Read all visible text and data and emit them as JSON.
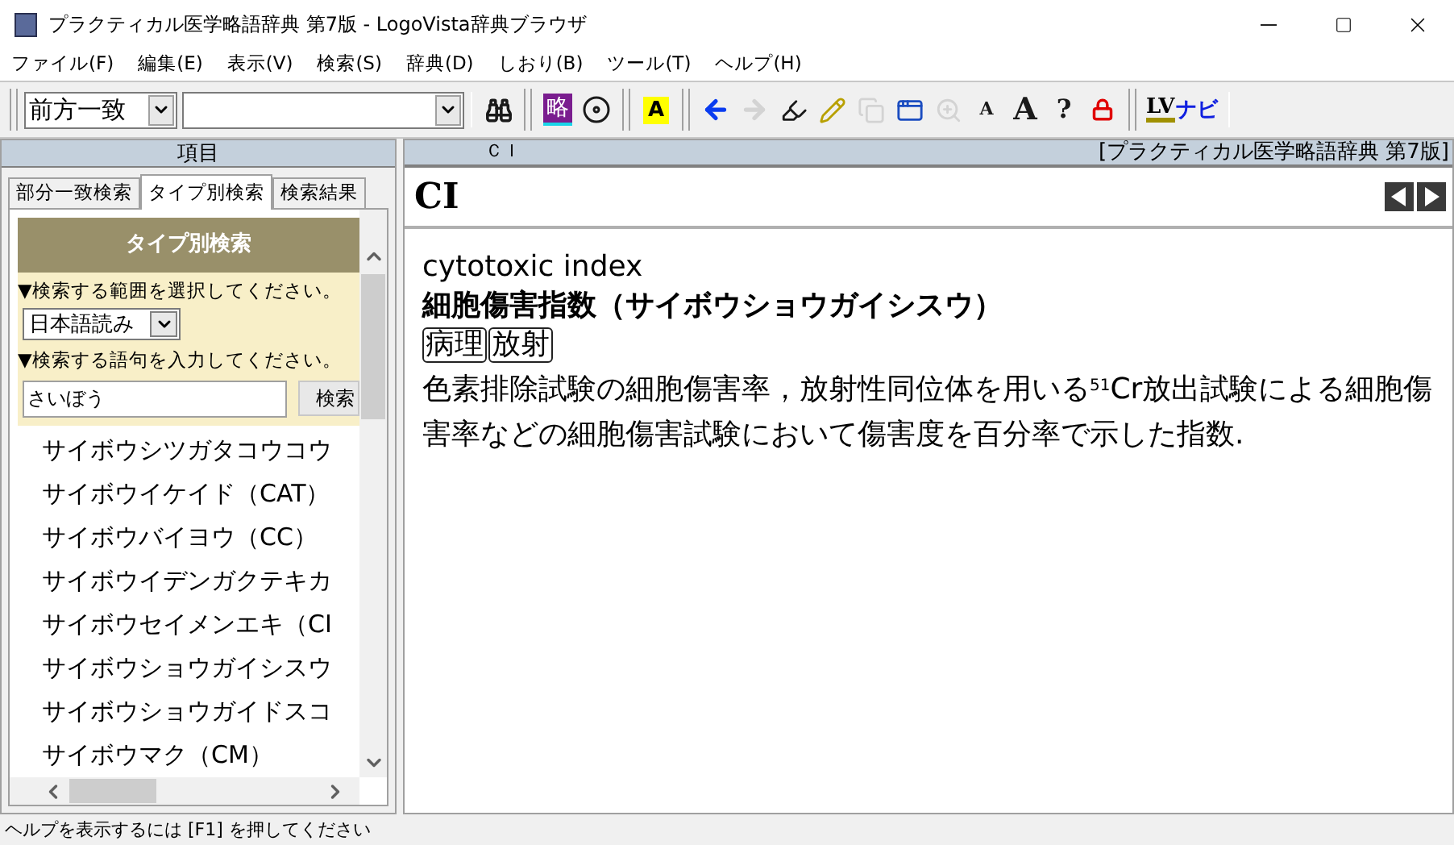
{
  "window": {
    "title": "プラクティカル医学略語辞典 第7版 - LogoVista辞典ブラウザ"
  },
  "menu": [
    "ファイル(F)",
    "編集(E)",
    "表示(V)",
    "検索(S)",
    "辞典(D)",
    "しおり(B)",
    "ツール(T)",
    "ヘルプ(H)"
  ],
  "toolbar": {
    "match_mode": "前方一致",
    "buttons": [
      {
        "kind": "binoculars",
        "disabled": false
      },
      {
        "kind": "sep"
      },
      {
        "kind": "abbr",
        "label": "略",
        "disabled": false
      },
      {
        "kind": "disc",
        "disabled": false
      },
      {
        "kind": "sep"
      },
      {
        "kind": "highlight",
        "label": "A",
        "disabled": false
      },
      {
        "kind": "sep"
      },
      {
        "kind": "back",
        "disabled": false
      },
      {
        "kind": "forward",
        "disabled": true
      },
      {
        "kind": "marker",
        "disabled": false
      },
      {
        "kind": "pencil",
        "disabled": false
      },
      {
        "kind": "copy",
        "disabled": true
      },
      {
        "kind": "window",
        "disabled": false
      },
      {
        "kind": "zoom",
        "disabled": true
      },
      {
        "kind": "font_small",
        "label": "A",
        "disabled": false
      },
      {
        "kind": "font_large",
        "label": "A",
        "disabled": false
      },
      {
        "kind": "help",
        "label": "?",
        "disabled": false
      },
      {
        "kind": "lock",
        "disabled": false
      },
      {
        "kind": "sep"
      },
      {
        "kind": "nav",
        "label": "LV",
        "label_2": "ナビ",
        "disabled": false
      }
    ]
  },
  "left_pane": {
    "header": "項目",
    "tabs": [
      {
        "label": "部分一致検索",
        "selected": false
      },
      {
        "label": "タイプ別検索",
        "selected": true
      },
      {
        "label": "検索結果",
        "selected": false
      }
    ],
    "panel_title": "タイプ別検索",
    "range_label": "▼検索する範囲を選択してください。",
    "range_value": "日本語読み",
    "term_label": "▼検索する語句を入力してください。",
    "term_value": "さいぼう",
    "search_button": "検索",
    "results": [
      {
        "text": "サイボウシツガタコウコウ",
        "selected": false
      },
      {
        "text": "サイボウイケイド（CAT）",
        "selected": false
      },
      {
        "text": "サイボウバイヨウ（CC）",
        "selected": false
      },
      {
        "text": "サイボウイデンガクテキカ",
        "selected": false
      },
      {
        "text": "サイボウセイメンエキ（CI",
        "selected": false
      },
      {
        "text": "サイボウショウガイシスウ",
        "selected": false
      },
      {
        "text": "サイボウショウガイドスコ",
        "selected": false
      },
      {
        "text": "サイボウマク（CM）",
        "selected": false
      }
    ]
  },
  "right_pane": {
    "header_term": "ＣＩ",
    "dictionary": "[プラクティカル医学略語辞典 第7版]",
    "headword": "CI",
    "english": "cytotoxic index",
    "japanese": "細胞傷害指数（サイボウショウガイシスウ）",
    "tags": [
      "病理",
      "放射"
    ],
    "definition": "色素排除試験の細胞傷害率，放射性同位体を用いる$^{51}$Cr放出試験による細胞傷害率などの細胞傷害試験において傷害度を百分率で示した指数."
  },
  "status_bar": "ヘルプを表示するには [F1] を押してください"
}
